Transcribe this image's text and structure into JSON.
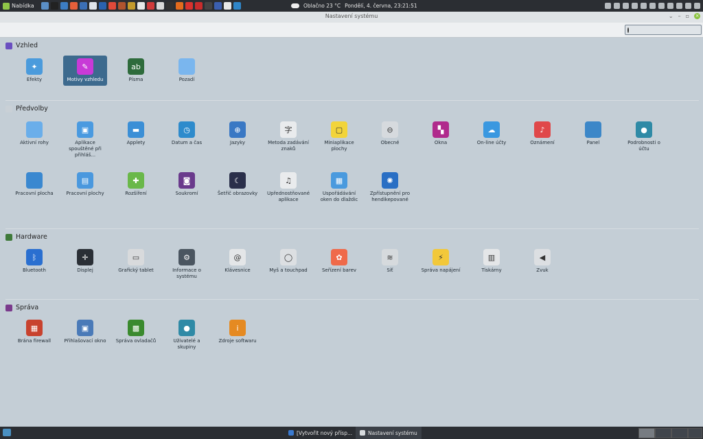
{
  "top_panel": {
    "menu_label": "Nabídka",
    "weather": "Oblačno 23 °C",
    "datetime": "Pondělí,  4. června, 23:21:51",
    "launcher_colors": [
      "#5b8fc6",
      "#222222",
      "#3c7dc4",
      "#e7603a",
      "#3b6fb5",
      "#dfe4ea",
      "#2a62b0",
      "#e04a3a",
      "#b0542e",
      "#c49a2c",
      "#e8e8e8",
      "#d13a3a",
      "#d9d9d9",
      "#333333",
      "#e36b1d",
      "#d9322e",
      "#c82c2c",
      "#444444",
      "#3b5fb0",
      "#e8e8e8",
      "#2f86c9"
    ],
    "tray_icons": [
      "a-icon",
      "1-icon",
      "shield-icon",
      "update-icon",
      "network-icon",
      "usb-icon",
      "power-icon",
      "user-icon",
      "users-icon",
      "volume-icon",
      "battery-icon"
    ]
  },
  "window": {
    "title": "Nastavení systému",
    "controls": [
      "minimize-icon",
      "maximize-icon",
      "restore-icon",
      "close-icon"
    ]
  },
  "search": {
    "value": "",
    "placeholder": ""
  },
  "sections": [
    {
      "title": "Vzhled",
      "color": "#6a4fc0",
      "items": [
        {
          "label": "Efekty",
          "color": "#4b9bdc",
          "glyph": "✦",
          "selected": false
        },
        {
          "label": "Motivy vzhledu",
          "color": "#c83ad7",
          "glyph": "✎",
          "selected": true
        },
        {
          "label": "Písma",
          "color": "#2e6b3c",
          "glyph": "ab",
          "selected": false
        },
        {
          "label": "Pozadí",
          "color": "#7ab6ee",
          "glyph": "",
          "selected": false
        }
      ]
    },
    {
      "title": "Předvolby",
      "color": "#c9d0d6",
      "items": [
        {
          "label": "Aktivní rohy",
          "color": "#6aaeea",
          "glyph": ""
        },
        {
          "label": "Aplikace spouštěné při přihláš...",
          "color": "#4a9ae0",
          "glyph": "▣"
        },
        {
          "label": "Applety",
          "color": "#3b8fd6",
          "glyph": "▬"
        },
        {
          "label": "Datum a čas",
          "color": "#2e8bcc",
          "glyph": "◷"
        },
        {
          "label": "Jazyky",
          "color": "#3a78c4",
          "glyph": "⊕"
        },
        {
          "label": "Metoda zadávání znaků",
          "color": "#e9ebed",
          "glyph": "字"
        },
        {
          "label": "Miniaplikace plochy",
          "color": "#f2d43a",
          "glyph": "▢"
        },
        {
          "label": "Obecné",
          "color": "#d6dade",
          "glyph": "⊖"
        },
        {
          "label": "Okna",
          "color": "#b02a8c",
          "glyph": "▚"
        },
        {
          "label": "On-line účty",
          "color": "#3a98e0",
          "glyph": "☁"
        },
        {
          "label": "Oznámení",
          "color": "#e0484a",
          "glyph": "♪"
        },
        {
          "label": "Panel",
          "color": "#3c87c8",
          "glyph": ""
        },
        {
          "label": "Podrobnosti o účtu",
          "color": "#2f8aa6",
          "glyph": "●"
        },
        {
          "label": "Pracovní plocha",
          "color": "#3a88d0",
          "glyph": ""
        },
        {
          "label": "Pracovní plochy",
          "color": "#4a98de",
          "glyph": "▤"
        },
        {
          "label": "Rozšíření",
          "color": "#6ab84a",
          "glyph": "✚"
        },
        {
          "label": "Soukromí",
          "color": "#6a3a8c",
          "glyph": "◙"
        },
        {
          "label": "Šetřič obrazovky",
          "color": "#2a2f4a",
          "glyph": "☾"
        },
        {
          "label": "Upřednostňované aplikace",
          "color": "#e9ebed",
          "glyph": "♫"
        },
        {
          "label": "Uspořádávání oken do dlaždic",
          "color": "#4a9ade",
          "glyph": "▦"
        },
        {
          "label": "Zpřístupnění pro hendikepované",
          "color": "#2a6fc4",
          "glyph": "✺"
        }
      ]
    },
    {
      "title": "Hardware",
      "color": "#3f7a3a",
      "items": [
        {
          "label": "Bluetooth",
          "color": "#2a6fd0",
          "glyph": "ᛒ"
        },
        {
          "label": "Displej",
          "color": "#2a2f36",
          "glyph": "✛"
        },
        {
          "label": "Grafický tablet",
          "color": "#d8dadc",
          "glyph": "▭"
        },
        {
          "label": "Informace o systému",
          "color": "#4a5560",
          "glyph": "⚙"
        },
        {
          "label": "Klávesnice",
          "color": "#e4e6e8",
          "glyph": "@"
        },
        {
          "label": "Myš a touchpad",
          "color": "#dcdfe2",
          "glyph": "◯"
        },
        {
          "label": "Seřízení barev",
          "color": "#ef6a4a",
          "glyph": "✿"
        },
        {
          "label": "Síť",
          "color": "#d6dadd",
          "glyph": "≋"
        },
        {
          "label": "Správa napájení",
          "color": "#f2c83a",
          "glyph": "⚡"
        },
        {
          "label": "Tiskárny",
          "color": "#e4e6e8",
          "glyph": "▥"
        },
        {
          "label": "Zvuk",
          "color": "#dcdfe2",
          "glyph": "◀"
        }
      ]
    },
    {
      "title": "Správa",
      "color": "#7a3a8c",
      "items": [
        {
          "label": "Brána firewall",
          "color": "#c8422e",
          "glyph": "▦"
        },
        {
          "label": "Přihlašovací okno",
          "color": "#4a7ab8",
          "glyph": "▣"
        },
        {
          "label": "Správa ovladačů",
          "color": "#3a8a2e",
          "glyph": "▩"
        },
        {
          "label": "Uživatelé a skupiny",
          "color": "#2f8aa6",
          "glyph": "●"
        },
        {
          "label": "Zdroje softwaru",
          "color": "#e58a22",
          "glyph": "i"
        }
      ]
    }
  ],
  "bottom_panel": {
    "tasks": [
      {
        "label": "[Vytvořit nový přísp...",
        "color": "#3a7ad0",
        "active": false
      },
      {
        "label": "Nastavení systému",
        "color": "#d6dadd",
        "active": true
      }
    ]
  }
}
